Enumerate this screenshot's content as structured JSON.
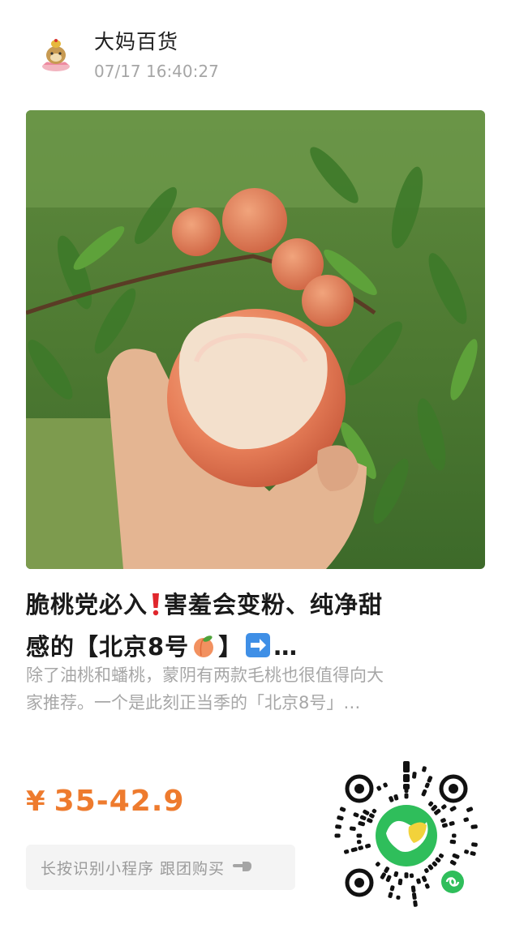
{
  "header": {
    "shop_name": "大妈百货",
    "timestamp": "07/17 16:40:27",
    "avatar_icon": "mascot-avatar-icon"
  },
  "product": {
    "title_line1": "脆桃党必入",
    "title_line1_rest": "害羞会变粉、纯净甜",
    "title_line2_a": "感的【北京8号",
    "title_line2_b": "】",
    "title_line2_end": "…",
    "title_emojis": [
      "exclamation-icon",
      "peach-icon",
      "right-arrow-icon"
    ],
    "description_line1": "除了油桃和蟠桃，蒙阴有两款毛桃也很值得向大",
    "description_line2": "家推荐。一个是此刻正当季的「北京8号」…",
    "price_currency": "¥",
    "price_range": "35-42.9",
    "price_color": "#ee7b2e"
  },
  "cta": {
    "label": "长按识别小程序 跟团购买",
    "icon": "hand-pointer-icon"
  },
  "qr": {
    "icon": "mini-program-qr-code",
    "badge": "mini-program-logo-icon"
  }
}
